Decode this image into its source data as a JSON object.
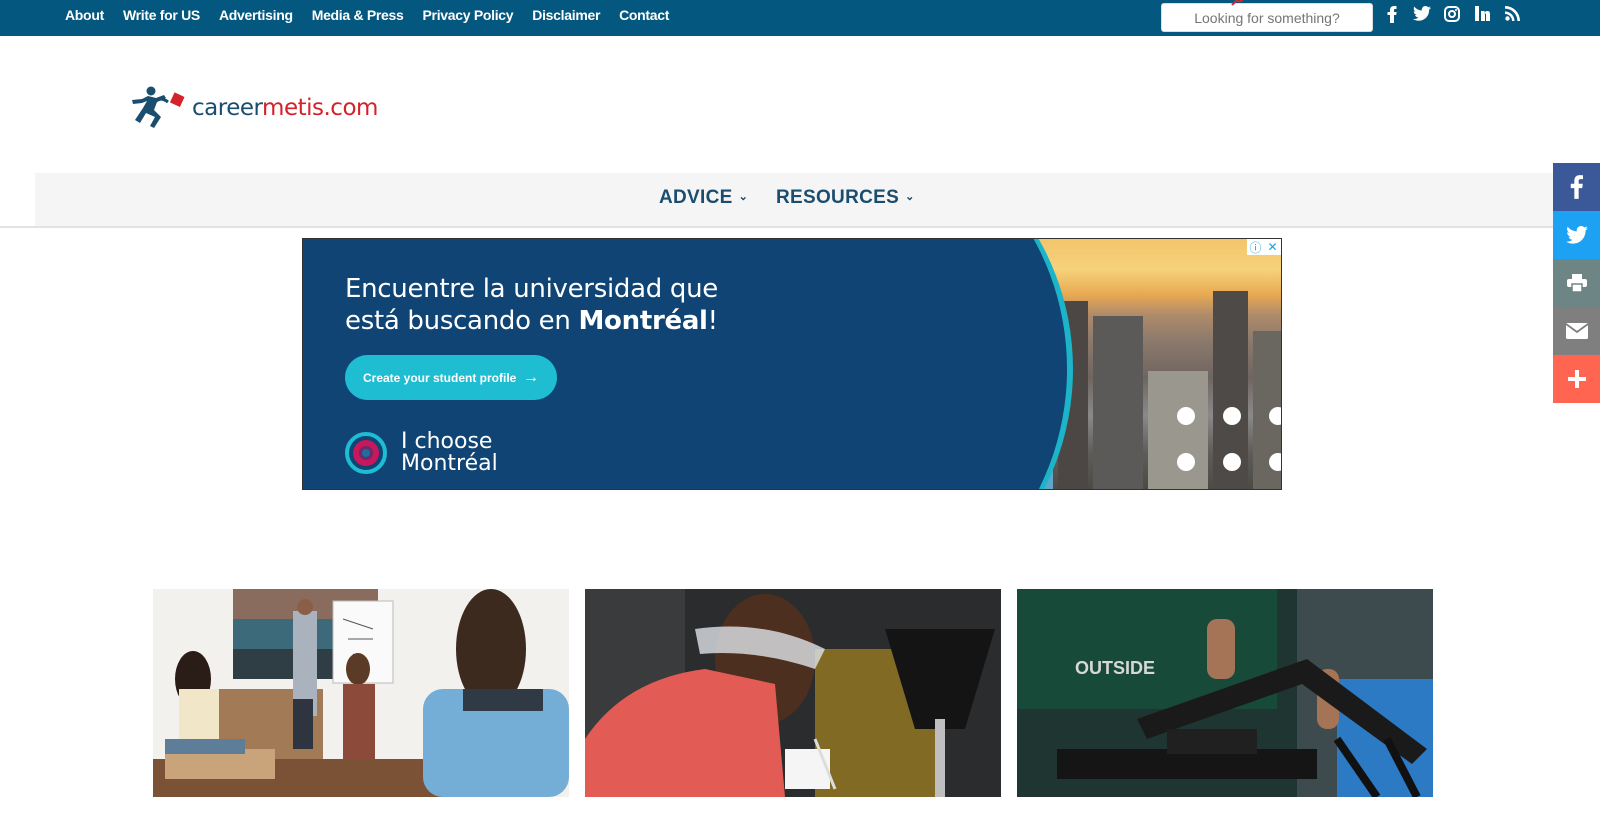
{
  "topbar": {
    "links": [
      "About",
      "Write for US",
      "Advertising",
      "Media & Press",
      "Privacy Policy",
      "Disclaimer",
      "Contact"
    ],
    "search": {
      "placeholder": "Looking for something?",
      "value": ""
    },
    "social": [
      "facebook-icon",
      "twitter-icon",
      "instagram-icon",
      "linkedin-icon",
      "rss-icon"
    ],
    "colors": {
      "background": "#04577f"
    }
  },
  "logo": {
    "part1": "career",
    "part2": "metis.com",
    "colors": {
      "primary": "#1b4d6e",
      "accent": "#d3222a"
    }
  },
  "mainnav": {
    "items": [
      {
        "label": "ADVICE",
        "icon": "chevron-down-icon"
      },
      {
        "label": "RESOURCES",
        "icon": "chevron-down-icon"
      }
    ]
  },
  "ad": {
    "headline_line1": "Encuentre la universidad que",
    "headline_line2_pre": "está buscando en ",
    "headline_line2_bold": "Montréal",
    "headline_line2_post": "!",
    "cta": "Create your student profile",
    "cta_arrow": "→",
    "brand_line1": "I choose",
    "brand_line2": "Montréal",
    "info_icon": "ⓘ",
    "close_icon": "✕",
    "colors": {
      "panel": "#0f4475",
      "cta": "#1ebdd2"
    }
  },
  "share_sidebar": [
    {
      "name": "facebook",
      "color": "#3b5998",
      "glyph": "f"
    },
    {
      "name": "twitter",
      "color": "#1da1f2",
      "glyph": "tw"
    },
    {
      "name": "print",
      "color": "#6d8584",
      "glyph": "print"
    },
    {
      "name": "email",
      "color": "#7f7f7f",
      "glyph": "mail"
    },
    {
      "name": "more",
      "color": "#ff6550",
      "glyph": "+"
    }
  ],
  "cards": [
    {
      "alt": "Presenter at whiteboard in meeting room"
    },
    {
      "alt": "Smiling mechanic in safety glasses with clipboard"
    },
    {
      "alt": "Person assembling rifle"
    }
  ]
}
